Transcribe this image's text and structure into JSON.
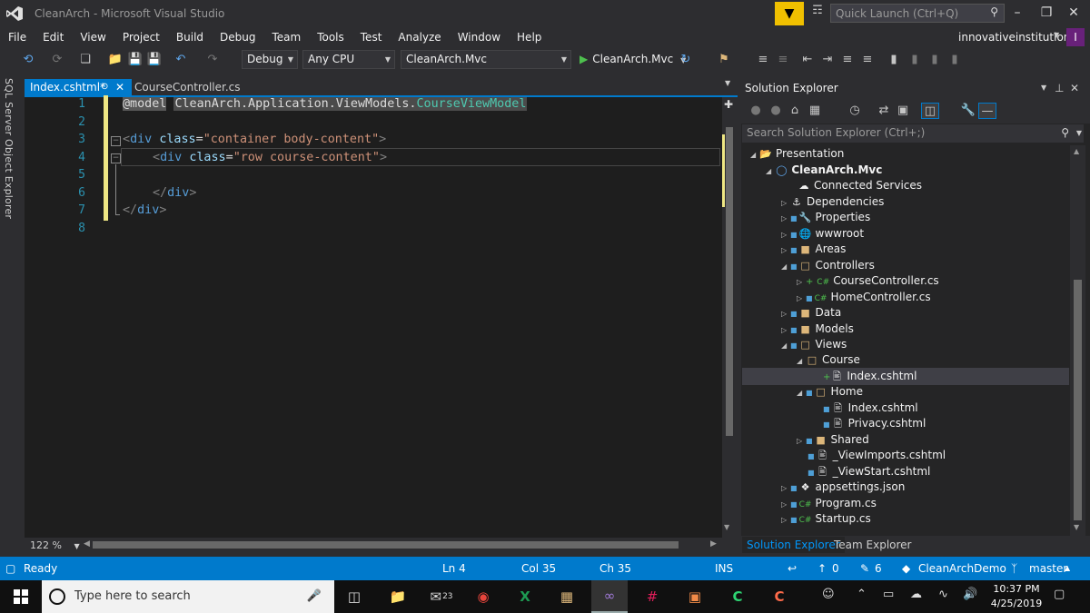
{
  "window": {
    "title": "CleanArch - Microsoft Visual Studio",
    "quick_launch_placeholder": "Quick Launch (Ctrl+Q)",
    "account": "innovativeinstitution",
    "avatar_initial": "I"
  },
  "menu": [
    "File",
    "Edit",
    "View",
    "Project",
    "Build",
    "Debug",
    "Team",
    "Tools",
    "Test",
    "Analyze",
    "Window",
    "Help"
  ],
  "toolbar": {
    "configuration": "Debug",
    "platform": "Any CPU",
    "startup_project": "CleanArch.Mvc",
    "run_target": "CleanArch.Mvc"
  },
  "side_tab": "SQL Server Object Explorer",
  "editor_tabs": [
    {
      "label": "Index.cshtml*",
      "active": true
    },
    {
      "label": "CourseController.cs",
      "active": false
    }
  ],
  "editor": {
    "zoom": "122 %",
    "line_numbers": [
      "1",
      "2",
      "3",
      "4",
      "5",
      "6",
      "7",
      "8"
    ],
    "lines": {
      "l1": {
        "kw": "@model",
        "ns": "CleanArch.Application.ViewModels.",
        "type": "CourseViewModel"
      },
      "l3": {
        "open": "<",
        "tag": "div",
        "attr": "class",
        "eq": "=",
        "val": "\"container body-content\"",
        "close": ">"
      },
      "l4": {
        "open": "<",
        "tag": "div",
        "attr": "class",
        "eq": "=",
        "val": "\"row course-content\"",
        "close": ">"
      },
      "l6": {
        "open": "</",
        "tag": "div",
        "close": ">"
      },
      "l7": {
        "open": "</",
        "tag": "div",
        "close": ">"
      }
    }
  },
  "solution_explorer": {
    "title": "Solution Explorer",
    "search_placeholder": "Search Solution Explorer (Ctrl+;)",
    "tree": {
      "presentation": "Presentation",
      "project": "CleanArch.Mvc",
      "connected": "Connected Services",
      "dependencies": "Dependencies",
      "properties": "Properties",
      "wwwroot": "wwwroot",
      "areas": "Areas",
      "controllers": "Controllers",
      "course_controller": "CourseController.cs",
      "home_controller": "HomeController.cs",
      "data": "Data",
      "models": "Models",
      "views": "Views",
      "course": "Course",
      "course_index": "Index.cshtml",
      "home": "Home",
      "home_index": "Index.cshtml",
      "privacy": "Privacy.cshtml",
      "shared": "Shared",
      "viewimports": "_ViewImports.cshtml",
      "viewstart": "_ViewStart.cshtml",
      "appsettings": "appsettings.json",
      "program": "Program.cs",
      "startup": "Startup.cs"
    },
    "bottom_tabs": [
      "Solution Explorer",
      "Team Explorer"
    ]
  },
  "status": {
    "state": "Ready",
    "ln": "Ln 4",
    "col": "Col 35",
    "ch": "Ch 35",
    "mode": "INS",
    "push_count": "0",
    "changes_count": "6",
    "repo": "CleanArchDemo",
    "branch": "master"
  },
  "taskbar": {
    "search_placeholder": "Type here to search",
    "mail_badge": "23",
    "time": "10:37 PM",
    "date": "4/25/2019"
  },
  "colors": {
    "accent": "#007acc",
    "editor_bg": "#1e1e1e",
    "chrome_bg": "#2d2d30",
    "filter_btn": "#f0c000",
    "change_marker": "#efe784"
  }
}
